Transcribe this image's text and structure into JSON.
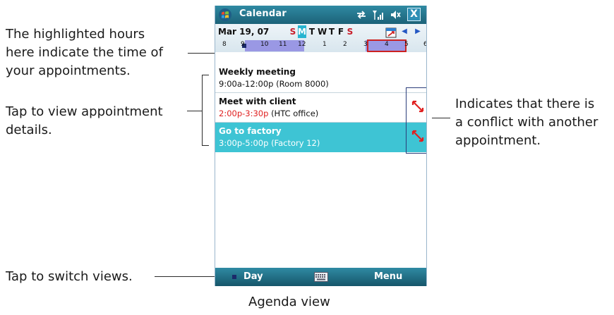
{
  "callouts": {
    "highlighted_hours": [
      "The highlighted hours",
      "here indicate the time of",
      "your appointments."
    ],
    "view_details": [
      "Tap to view appointment",
      "details."
    ],
    "conflict": [
      "Indicates that there is",
      "a conflict with another",
      "appointment."
    ],
    "switch_views": "Tap to switch views."
  },
  "titlebar": {
    "title": "Calendar",
    "icons": [
      "windows-start-icon",
      "connectivity-icon",
      "signal-icon",
      "volume-icon"
    ],
    "close_label": "X"
  },
  "datebar": {
    "date": "Mar 19, 07",
    "days": [
      "S",
      "M",
      "T",
      "W",
      "T",
      "F",
      "S"
    ],
    "selected_day": "M",
    "hours": [
      "8",
      "9",
      "10",
      "11",
      "12",
      "1",
      "2",
      "3",
      "4",
      "5",
      "6"
    ]
  },
  "appointments": [
    {
      "title": "Weekly meeting",
      "time": "9:00a-12:00p",
      "location": "(Room 8000)",
      "conflict": false,
      "selected": false
    },
    {
      "title": "Meet with client",
      "time": "2:00p-3:30p",
      "location": "(HTC office)",
      "conflict": true,
      "selected": false
    },
    {
      "title": "Go to factory",
      "time": "3:00p-5:00p",
      "location": "(Factory 12)",
      "conflict": true,
      "selected": true
    }
  ],
  "softkeys": {
    "left": "Day",
    "right": "Menu"
  },
  "caption": "Agenda view",
  "colors": {
    "accent": "#27b4d0",
    "titlebar": "#1c6278",
    "highlight": "#9a98e4",
    "conflict": "#cc2222",
    "selected_row": "#3ec4d4"
  }
}
